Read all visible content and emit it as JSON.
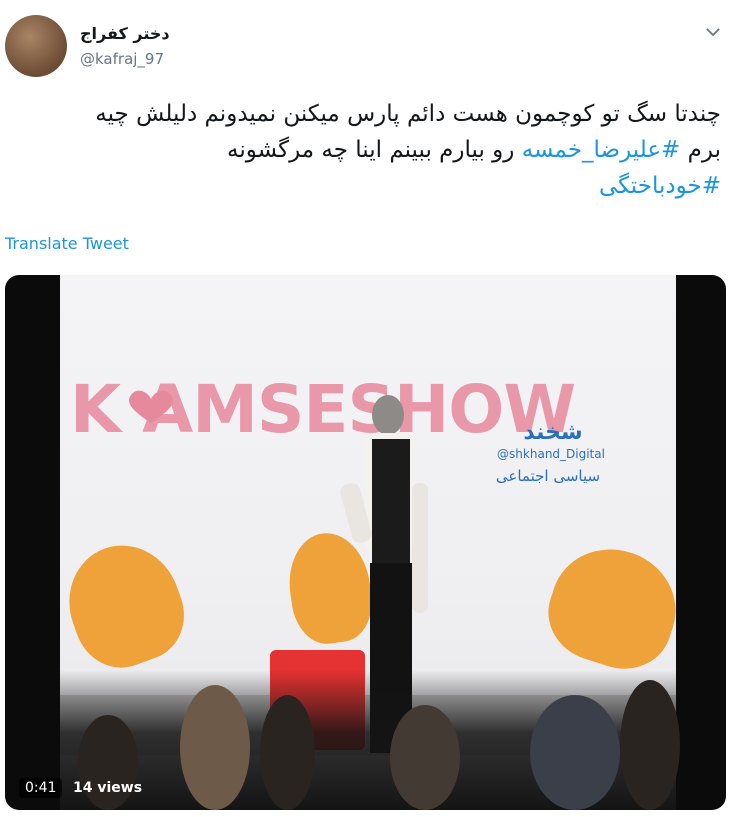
{
  "author": {
    "display_name": "دختر کفراج",
    "handle": "@kafraj_97"
  },
  "tweet": {
    "line1": "چندتا سگ تو کوچمون هست دائم پارس میکنن نمیدونم دلیلش چیه",
    "line2_prefix": "برم ",
    "line2_hashtag": "#علیرضا_خمسه",
    "line2_suffix": " رو بیارم ببینم اینا چه مرگشونه",
    "line3_hashtag": "#خودباختگی"
  },
  "translate_label": "Translate Tweet",
  "video": {
    "banner_text": "K AMSESHOW",
    "logo_main": "شخند",
    "logo_sub": "@shkhand_Digital",
    "logo_sub2": "سیاسی اجتماعی",
    "duration": "0:41",
    "views": "14 views"
  },
  "icons": {
    "menu": "chevron-down-icon"
  },
  "colors": {
    "link": "#1b95e0",
    "text": "#14171a",
    "muted": "#657786"
  }
}
